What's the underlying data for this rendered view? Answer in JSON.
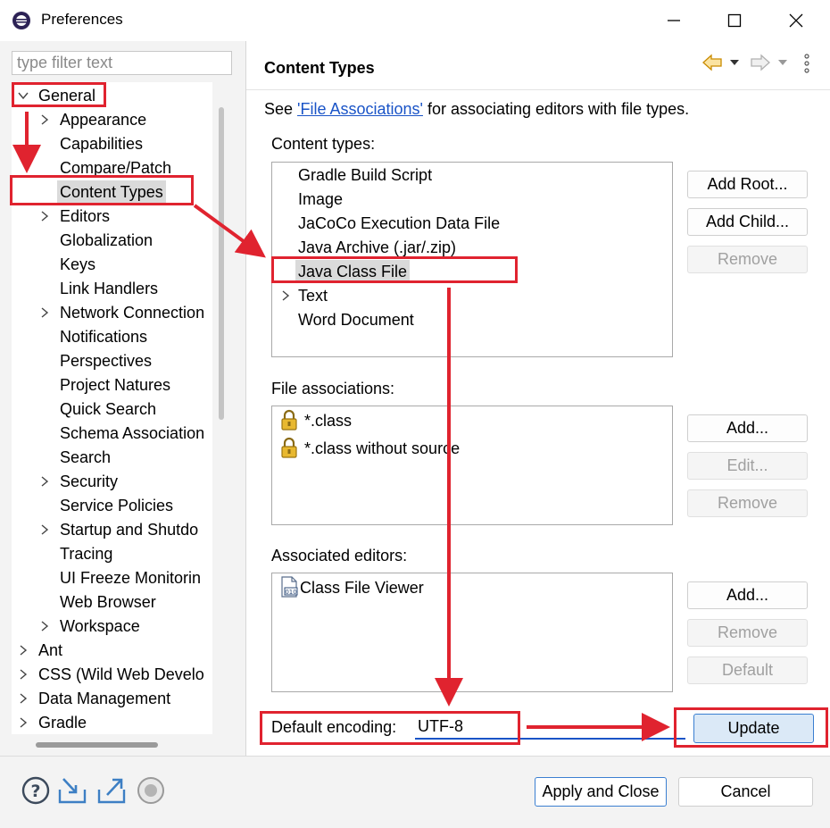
{
  "window": {
    "title": "Preferences"
  },
  "filter": {
    "placeholder": "type filter text"
  },
  "tree": {
    "items": [
      {
        "label": "General",
        "level": 0,
        "expanded": true
      },
      {
        "label": "Appearance",
        "level": 1,
        "has_children": true
      },
      {
        "label": "Capabilities",
        "level": 1
      },
      {
        "label": "Compare/Patch",
        "level": 1
      },
      {
        "label": "Content Types",
        "level": 1,
        "selected": true
      },
      {
        "label": "Editors",
        "level": 1,
        "has_children": true
      },
      {
        "label": "Globalization",
        "level": 1
      },
      {
        "label": "Keys",
        "level": 1
      },
      {
        "label": "Link Handlers",
        "level": 1
      },
      {
        "label": "Network Connection",
        "level": 1,
        "has_children": true
      },
      {
        "label": "Notifications",
        "level": 1
      },
      {
        "label": "Perspectives",
        "level": 1
      },
      {
        "label": "Project Natures",
        "level": 1
      },
      {
        "label": "Quick Search",
        "level": 1
      },
      {
        "label": "Schema Association",
        "level": 1
      },
      {
        "label": "Search",
        "level": 1
      },
      {
        "label": "Security",
        "level": 1,
        "has_children": true
      },
      {
        "label": "Service Policies",
        "level": 1
      },
      {
        "label": "Startup and Shutdo",
        "level": 1,
        "has_children": true
      },
      {
        "label": "Tracing",
        "level": 1
      },
      {
        "label": "UI Freeze Monitorin",
        "level": 1
      },
      {
        "label": "Web Browser",
        "level": 1
      },
      {
        "label": "Workspace",
        "level": 1,
        "has_children": true
      },
      {
        "label": "Ant",
        "level": 0,
        "has_children": true
      },
      {
        "label": "CSS (Wild Web Develo",
        "level": 0,
        "has_children": true
      },
      {
        "label": "Data Management",
        "level": 0,
        "has_children": true
      },
      {
        "label": "Gradle",
        "level": 0,
        "has_children": true
      }
    ]
  },
  "page": {
    "title": "Content Types",
    "see_prefix": "See ",
    "see_link": "'File Associations'",
    "see_suffix": " for associating editors with file types."
  },
  "content_types": {
    "label": "Content types:",
    "items": [
      {
        "label": "Gradle Build Script"
      },
      {
        "label": "Image"
      },
      {
        "label": "JaCoCo Execution Data File"
      },
      {
        "label": "Java Archive (.jar/.zip)"
      },
      {
        "label": "Java Class File",
        "selected": true
      },
      {
        "label": "Text",
        "has_children": true
      },
      {
        "label": "Word Document"
      }
    ],
    "buttons": {
      "add_root": "Add Root...",
      "add_child": "Add Child...",
      "remove": "Remove"
    }
  },
  "file_associations": {
    "label": "File associations:",
    "items": [
      {
        "label": "*.class",
        "icon": "lock-icon"
      },
      {
        "label": "*.class without source",
        "icon": "lock-icon"
      }
    ],
    "buttons": {
      "add": "Add...",
      "edit": "Edit...",
      "remove": "Remove"
    }
  },
  "associated_editors": {
    "label": "Associated editors:",
    "items": [
      {
        "label": "Class File Viewer",
        "icon": "class-file-icon"
      }
    ],
    "buttons": {
      "add": "Add...",
      "remove": "Remove",
      "default": "Default"
    }
  },
  "encoding": {
    "label": "Default encoding:",
    "value": "UTF-8",
    "update": "Update"
  },
  "footer": {
    "apply_close": "Apply and Close",
    "cancel": "Cancel"
  },
  "colors": {
    "annotation_red": "#e0232f",
    "link_blue": "#1a54c7",
    "update_bg": "#dbe9f7"
  }
}
